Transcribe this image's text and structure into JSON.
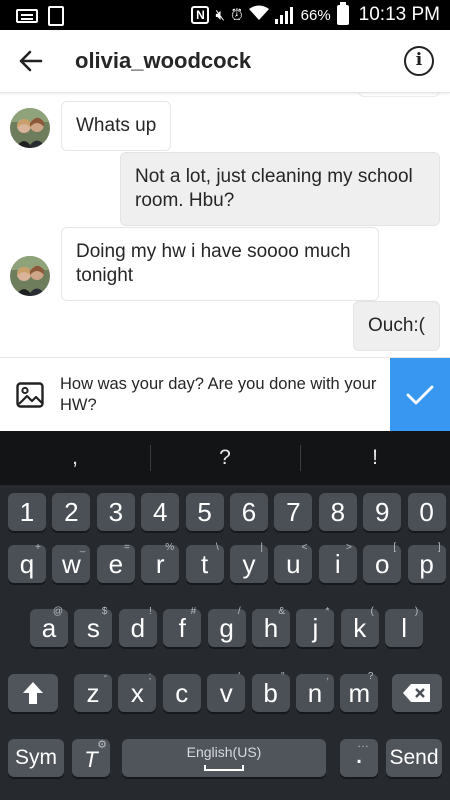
{
  "status_bar": {
    "battery": "66%",
    "time": "10:13 PM"
  },
  "header": {
    "title": "olivia_woodcock"
  },
  "messages": [
    {
      "side": "in",
      "text": "Whats up",
      "avatar": true
    },
    {
      "side": "out",
      "text": "Not a lot, just cleaning my school room. Hbu?"
    },
    {
      "side": "in",
      "text": "Doing my hw i have soooo much tonight",
      "avatar": true
    },
    {
      "side": "out",
      "text": "Ouch:("
    }
  ],
  "compose": {
    "text": "How was your day? Are you done with your HW?"
  },
  "colors": {
    "accent": "#3897f0",
    "keyboard_bg": "#262a2f",
    "key_bg": "#4b5056"
  },
  "keyboard": {
    "suggestions": [
      ",",
      "?",
      "!"
    ],
    "number_row": [
      "1",
      "2",
      "3",
      "4",
      "5",
      "6",
      "7",
      "8",
      "9",
      "0"
    ],
    "row1": [
      {
        "k": "q",
        "h": "+"
      },
      {
        "k": "w",
        "h": "_"
      },
      {
        "k": "e",
        "h": "="
      },
      {
        "k": "r",
        "h": "%"
      },
      {
        "k": "t",
        "h": "\\"
      },
      {
        "k": "y",
        "h": "|"
      },
      {
        "k": "u",
        "h": "<"
      },
      {
        "k": "i",
        "h": ">"
      },
      {
        "k": "o",
        "h": "["
      },
      {
        "k": "p",
        "h": "]"
      }
    ],
    "row2": [
      {
        "k": "a",
        "h": "@"
      },
      {
        "k": "s",
        "h": "$"
      },
      {
        "k": "d",
        "h": "!"
      },
      {
        "k": "f",
        "h": "#"
      },
      {
        "k": "g",
        "h": "/"
      },
      {
        "k": "h",
        "h": "&"
      },
      {
        "k": "j",
        "h": "*"
      },
      {
        "k": "k",
        "h": "("
      },
      {
        "k": "l",
        "h": ")"
      }
    ],
    "row3": [
      {
        "k": "z",
        "h": "-"
      },
      {
        "k": "x",
        "h": ";"
      },
      {
        "k": "c",
        "h": ""
      },
      {
        "k": "v",
        "h": "'"
      },
      {
        "k": "b",
        "h": "\""
      },
      {
        "k": "n",
        "h": ","
      },
      {
        "k": "m",
        "h": "?"
      }
    ],
    "sym_label": "Sym",
    "space_label": "English(US)",
    "period_label": ".",
    "send_label": "Send"
  }
}
